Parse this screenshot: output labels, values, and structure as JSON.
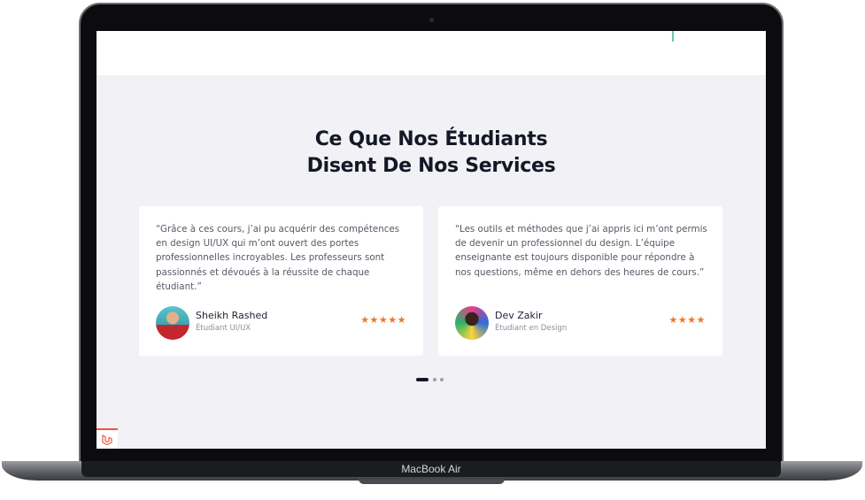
{
  "device": {
    "model_label": "MacBook Air"
  },
  "section": {
    "title_line1": "Ce Que Nos Étudiants",
    "title_line2": "Disent De Nos Services"
  },
  "testimonials": [
    {
      "quote": "“Grâce à ces cours, j’ai pu acquérir des compétences en design UI/UX qui m’ont ouvert des portes professionnelles incroyables. Les professeurs sont passionnés et dévoués à la réussite de chaque étudiant.”",
      "name": "Sheikh Rashed",
      "role": "Étudiant UI/UX",
      "rating": 5,
      "stars": "★★★★★"
    },
    {
      "quote": "“Les outils et méthodes que j’ai appris ici m’ont permis de devenir un professionnel du design. L’équipe enseignante est toujours disponible pour répondre à nos questions, même en dehors des heures de cours.”",
      "name": "Dev Zakir",
      "role": "Étudiant en Design",
      "rating": 4,
      "stars": "★★★★"
    }
  ],
  "carousel": {
    "page_count": 3,
    "active_page": 1
  },
  "colors": {
    "accent_star": "#f07628",
    "section_bg": "#f2f2f6",
    "title": "#141826",
    "laravel_red": "#f05340"
  },
  "icons": [
    "camera-icon",
    "star-icon",
    "laravel-logo-icon"
  ]
}
